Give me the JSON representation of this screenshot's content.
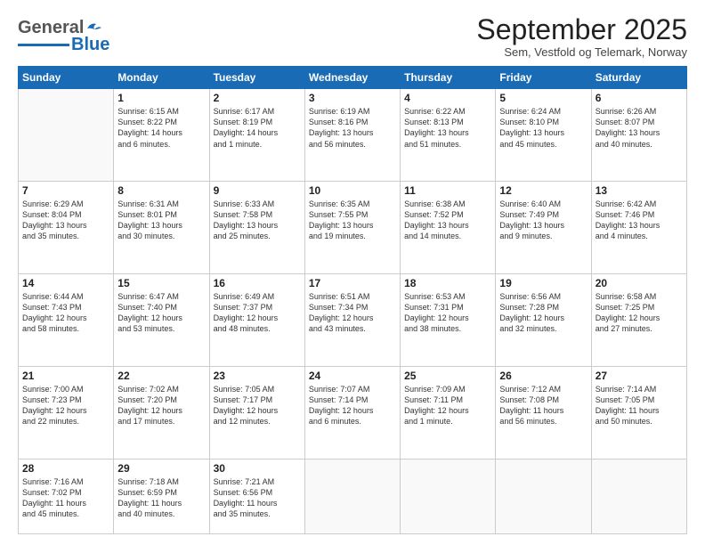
{
  "logo": {
    "text1": "General",
    "text2": "Blue"
  },
  "title": "September 2025",
  "subtitle": "Sem, Vestfold og Telemark, Norway",
  "weekdays": [
    "Sunday",
    "Monday",
    "Tuesday",
    "Wednesday",
    "Thursday",
    "Friday",
    "Saturday"
  ],
  "weeks": [
    [
      {
        "day": "",
        "info": ""
      },
      {
        "day": "1",
        "info": "Sunrise: 6:15 AM\nSunset: 8:22 PM\nDaylight: 14 hours\nand 6 minutes."
      },
      {
        "day": "2",
        "info": "Sunrise: 6:17 AM\nSunset: 8:19 PM\nDaylight: 14 hours\nand 1 minute."
      },
      {
        "day": "3",
        "info": "Sunrise: 6:19 AM\nSunset: 8:16 PM\nDaylight: 13 hours\nand 56 minutes."
      },
      {
        "day": "4",
        "info": "Sunrise: 6:22 AM\nSunset: 8:13 PM\nDaylight: 13 hours\nand 51 minutes."
      },
      {
        "day": "5",
        "info": "Sunrise: 6:24 AM\nSunset: 8:10 PM\nDaylight: 13 hours\nand 45 minutes."
      },
      {
        "day": "6",
        "info": "Sunrise: 6:26 AM\nSunset: 8:07 PM\nDaylight: 13 hours\nand 40 minutes."
      }
    ],
    [
      {
        "day": "7",
        "info": "Sunrise: 6:29 AM\nSunset: 8:04 PM\nDaylight: 13 hours\nand 35 minutes."
      },
      {
        "day": "8",
        "info": "Sunrise: 6:31 AM\nSunset: 8:01 PM\nDaylight: 13 hours\nand 30 minutes."
      },
      {
        "day": "9",
        "info": "Sunrise: 6:33 AM\nSunset: 7:58 PM\nDaylight: 13 hours\nand 25 minutes."
      },
      {
        "day": "10",
        "info": "Sunrise: 6:35 AM\nSunset: 7:55 PM\nDaylight: 13 hours\nand 19 minutes."
      },
      {
        "day": "11",
        "info": "Sunrise: 6:38 AM\nSunset: 7:52 PM\nDaylight: 13 hours\nand 14 minutes."
      },
      {
        "day": "12",
        "info": "Sunrise: 6:40 AM\nSunset: 7:49 PM\nDaylight: 13 hours\nand 9 minutes."
      },
      {
        "day": "13",
        "info": "Sunrise: 6:42 AM\nSunset: 7:46 PM\nDaylight: 13 hours\nand 4 minutes."
      }
    ],
    [
      {
        "day": "14",
        "info": "Sunrise: 6:44 AM\nSunset: 7:43 PM\nDaylight: 12 hours\nand 58 minutes."
      },
      {
        "day": "15",
        "info": "Sunrise: 6:47 AM\nSunset: 7:40 PM\nDaylight: 12 hours\nand 53 minutes."
      },
      {
        "day": "16",
        "info": "Sunrise: 6:49 AM\nSunset: 7:37 PM\nDaylight: 12 hours\nand 48 minutes."
      },
      {
        "day": "17",
        "info": "Sunrise: 6:51 AM\nSunset: 7:34 PM\nDaylight: 12 hours\nand 43 minutes."
      },
      {
        "day": "18",
        "info": "Sunrise: 6:53 AM\nSunset: 7:31 PM\nDaylight: 12 hours\nand 38 minutes."
      },
      {
        "day": "19",
        "info": "Sunrise: 6:56 AM\nSunset: 7:28 PM\nDaylight: 12 hours\nand 32 minutes."
      },
      {
        "day": "20",
        "info": "Sunrise: 6:58 AM\nSunset: 7:25 PM\nDaylight: 12 hours\nand 27 minutes."
      }
    ],
    [
      {
        "day": "21",
        "info": "Sunrise: 7:00 AM\nSunset: 7:23 PM\nDaylight: 12 hours\nand 22 minutes."
      },
      {
        "day": "22",
        "info": "Sunrise: 7:02 AM\nSunset: 7:20 PM\nDaylight: 12 hours\nand 17 minutes."
      },
      {
        "day": "23",
        "info": "Sunrise: 7:05 AM\nSunset: 7:17 PM\nDaylight: 12 hours\nand 12 minutes."
      },
      {
        "day": "24",
        "info": "Sunrise: 7:07 AM\nSunset: 7:14 PM\nDaylight: 12 hours\nand 6 minutes."
      },
      {
        "day": "25",
        "info": "Sunrise: 7:09 AM\nSunset: 7:11 PM\nDaylight: 12 hours\nand 1 minute."
      },
      {
        "day": "26",
        "info": "Sunrise: 7:12 AM\nSunset: 7:08 PM\nDaylight: 11 hours\nand 56 minutes."
      },
      {
        "day": "27",
        "info": "Sunrise: 7:14 AM\nSunset: 7:05 PM\nDaylight: 11 hours\nand 50 minutes."
      }
    ],
    [
      {
        "day": "28",
        "info": "Sunrise: 7:16 AM\nSunset: 7:02 PM\nDaylight: 11 hours\nand 45 minutes."
      },
      {
        "day": "29",
        "info": "Sunrise: 7:18 AM\nSunset: 6:59 PM\nDaylight: 11 hours\nand 40 minutes."
      },
      {
        "day": "30",
        "info": "Sunrise: 7:21 AM\nSunset: 6:56 PM\nDaylight: 11 hours\nand 35 minutes."
      },
      {
        "day": "",
        "info": ""
      },
      {
        "day": "",
        "info": ""
      },
      {
        "day": "",
        "info": ""
      },
      {
        "day": "",
        "info": ""
      }
    ]
  ]
}
